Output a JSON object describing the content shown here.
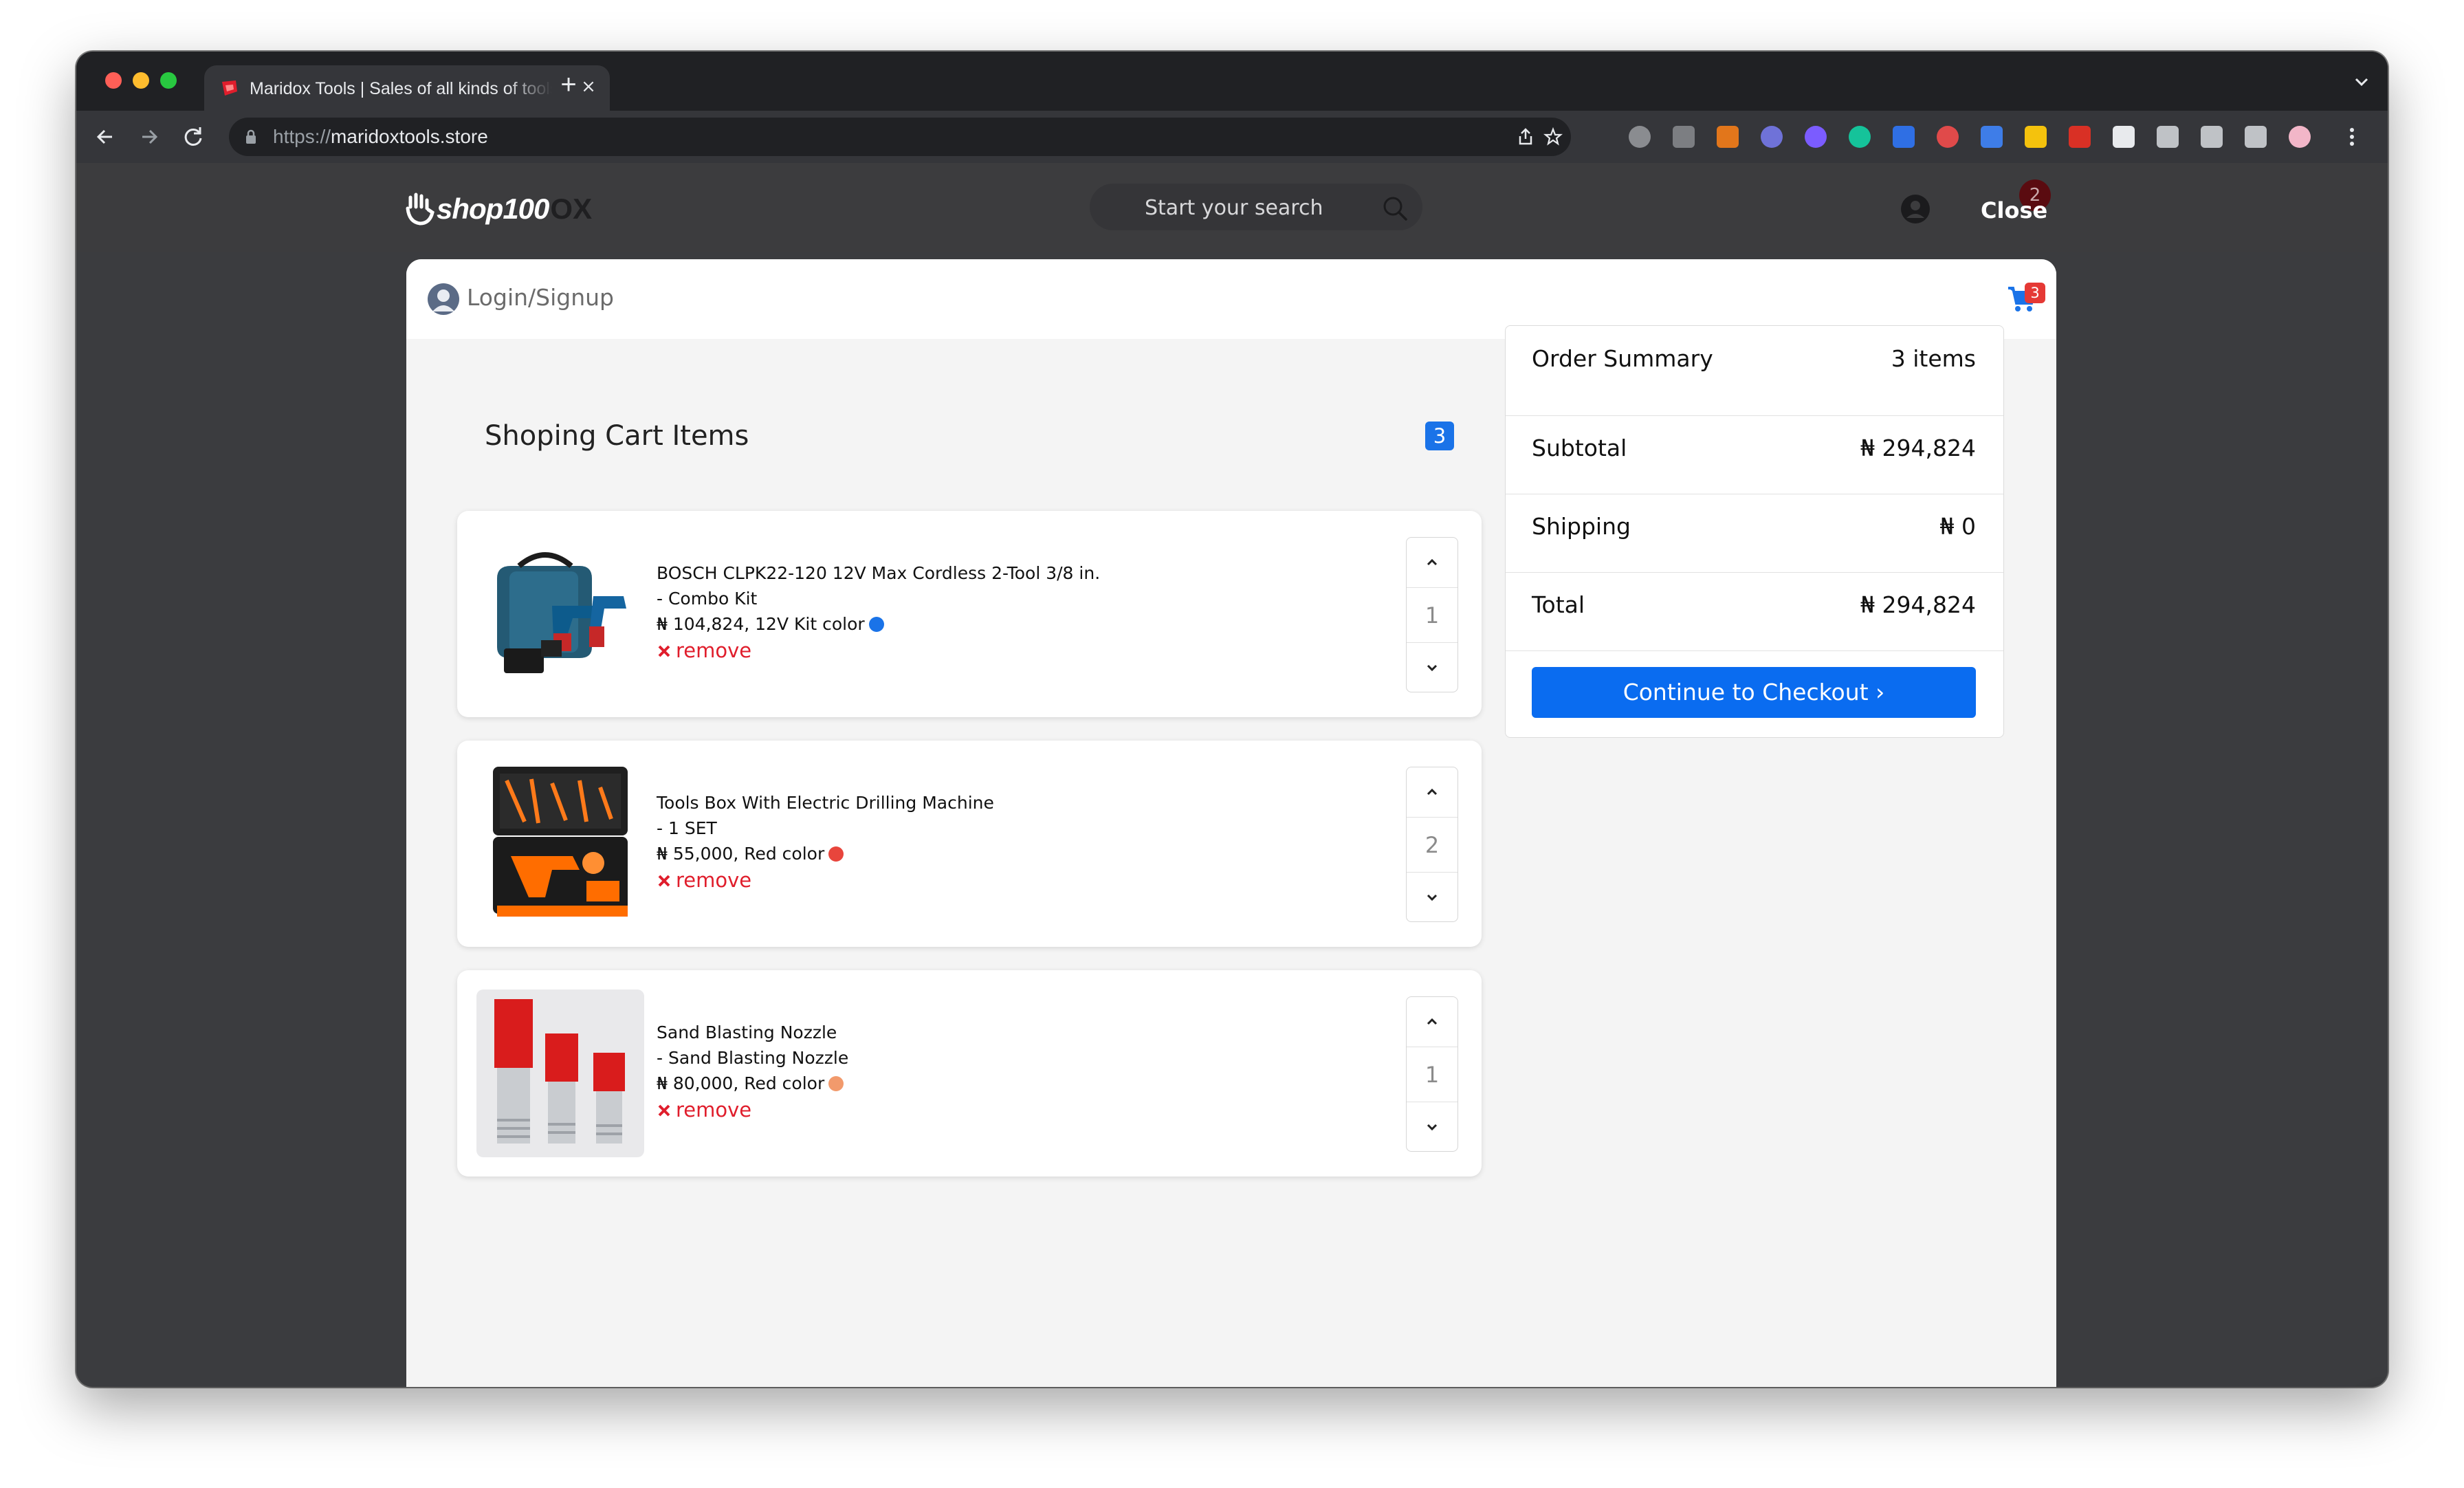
{
  "browser": {
    "tab_title": "Maridox Tools | Sales of all kinds of tools",
    "url_scheme": "https://",
    "url_host": "maridoxtools.store"
  },
  "header": {
    "logo_text": "shop100",
    "logo_suffix": "OX",
    "search_placeholder": "Start your search",
    "badge_count": "2",
    "close_label": "Close"
  },
  "panel": {
    "login_label": "Login/Signup",
    "cart_count": "3"
  },
  "cart": {
    "title": "Shoping Cart Items",
    "count": "3",
    "items": [
      {
        "name": "BOSCH CLPK22-120 12V Max Cordless 2-Tool 3/8 in.",
        "variant": "- Combo Kit",
        "price_line": "₦ 104,824, 12V Kit color",
        "dot_color": "#1a73e8",
        "remove_label": "remove",
        "quantity": "1"
      },
      {
        "name": "Tools Box With Electric Drilling Machine",
        "variant": "- 1 SET",
        "price_line": "₦ 55,000, Red color",
        "dot_color": "#e8453c",
        "remove_label": "remove",
        "quantity": "2"
      },
      {
        "name": "Sand Blasting Nozzle",
        "variant": "- Sand Blasting Nozzle",
        "price_line": "₦ 80,000, Red color",
        "dot_color": "#f29a6c",
        "remove_label": "remove",
        "quantity": "1"
      }
    ]
  },
  "summary": {
    "title": "Order Summary",
    "items_label": "3 items",
    "subtotal_label": "Subtotal",
    "subtotal_value": "₦ 294,824",
    "shipping_label": "Shipping",
    "shipping_value": "₦ 0",
    "total_label": "Total",
    "total_value": "₦ 294,824",
    "checkout_label": "Continue to Checkout ›"
  },
  "colors": {
    "accent": "#0a6cf0",
    "danger": "#e01e2c"
  }
}
